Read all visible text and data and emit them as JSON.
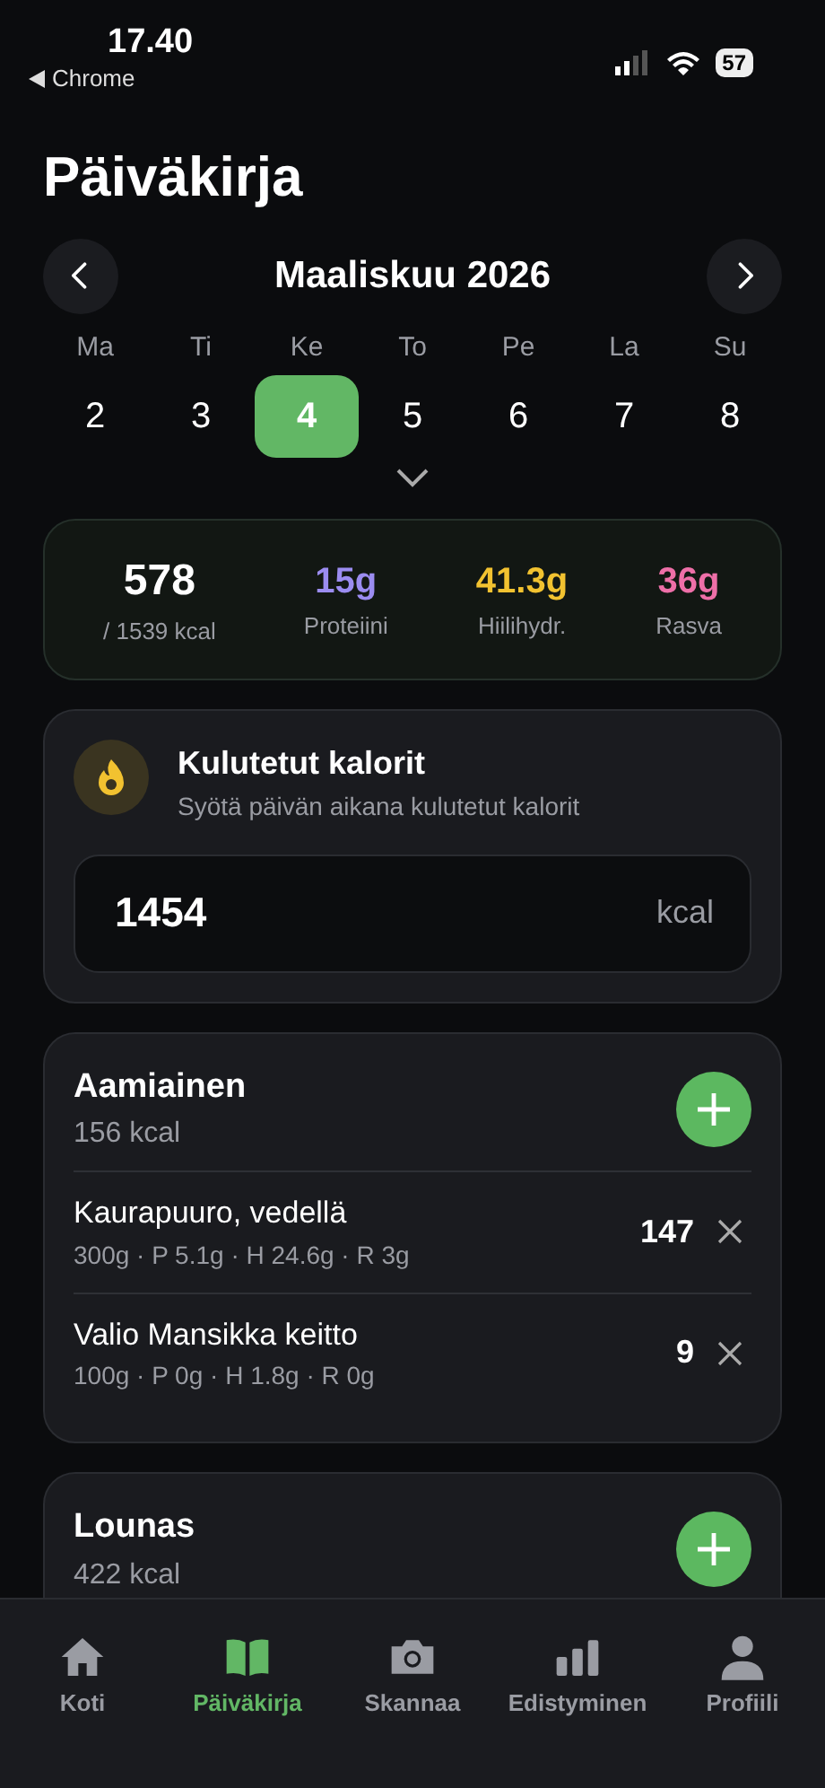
{
  "status_bar": {
    "time": "17.40",
    "back_label": "Chrome",
    "battery": "57"
  },
  "title": "Päiväkirja",
  "calendar": {
    "month": "Maaliskuu 2026",
    "days": [
      {
        "weekday": "Ma",
        "date": "2",
        "selected": false
      },
      {
        "weekday": "Ti",
        "date": "3",
        "selected": false
      },
      {
        "weekday": "Ke",
        "date": "4",
        "selected": true
      },
      {
        "weekday": "To",
        "date": "5",
        "selected": false
      },
      {
        "weekday": "Pe",
        "date": "6",
        "selected": false
      },
      {
        "weekday": "La",
        "date": "7",
        "selected": false
      },
      {
        "weekday": "Su",
        "date": "8",
        "selected": false
      }
    ]
  },
  "summary": {
    "calories": "578",
    "goal": "/ 1539 kcal",
    "macros": [
      {
        "value": "15g",
        "label": "Proteiini",
        "color": "#9b8cf0"
      },
      {
        "value": "41.3g",
        "label": "Hiilihydr.",
        "color": "#f2c230"
      },
      {
        "value": "36g",
        "label": "Rasva",
        "color": "#ee6fa8"
      }
    ]
  },
  "burned": {
    "title": "Kulutetut kalorit",
    "subtitle": "Syötä päivän aikana kulutetut kalorit",
    "value": "1454",
    "unit": "kcal"
  },
  "meals": [
    {
      "name": "Aamiainen",
      "kcal": "156 kcal",
      "items": [
        {
          "name": "Kaurapuuro, vedellä",
          "details": "300g · P 5.1g · H 24.6g · R 3g",
          "kcal": "147"
        },
        {
          "name": "Valio Mansikka keitto",
          "details": "100g · P 0g · H 1.8g · R 0g",
          "kcal": "9"
        }
      ]
    },
    {
      "name": "Lounas",
      "kcal": "422 kcal"
    }
  ],
  "tabs": [
    {
      "label": "Koti",
      "selected": false
    },
    {
      "label": "Päiväkirja",
      "selected": true
    },
    {
      "label": "Skannaa",
      "selected": false
    },
    {
      "label": "Edistyminen",
      "selected": false
    },
    {
      "label": "Profiili",
      "selected": false
    }
  ]
}
